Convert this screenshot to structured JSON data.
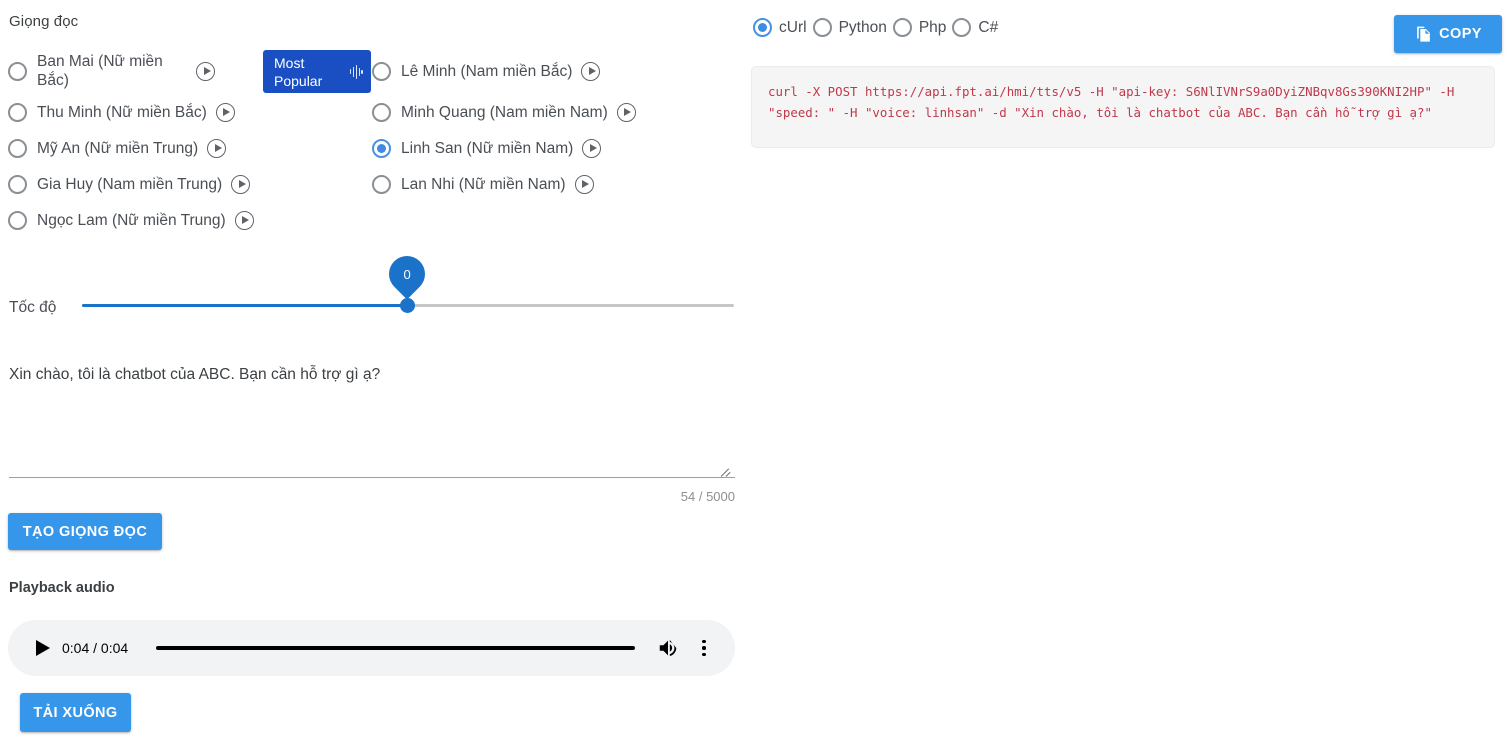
{
  "voice_section": {
    "label": "Giọng đọc",
    "column_left": [
      {
        "name": "Ban Mai (Nữ miền Bắc)",
        "selected": false,
        "play_icon": "play-circle-icon",
        "wrap": true
      },
      {
        "name": "Thu Minh (Nữ miền Bắc)",
        "selected": false,
        "play_icon": "play-circle-icon",
        "wrap": false
      },
      {
        "name": "Mỹ An (Nữ miền Trung)",
        "selected": false,
        "play_icon": "play-circle-icon",
        "wrap": false
      },
      {
        "name": "Gia Huy (Nam miền Trung)",
        "selected": false,
        "play_icon": "play-circle-icon",
        "wrap": false
      },
      {
        "name": "Ngọc Lam (Nữ miền Trung)",
        "selected": false,
        "play_icon": "play-circle-icon",
        "wrap": false
      }
    ],
    "column_right": [
      {
        "name": "Lê Minh (Nam miền Bắc)",
        "selected": false,
        "play_icon": "play-circle-icon",
        "wrap": false
      },
      {
        "name": "Minh Quang (Nam miền Nam)",
        "selected": false,
        "play_icon": "play-circle-icon",
        "wrap": false
      },
      {
        "name": "Linh San (Nữ miền Nam)",
        "selected": true,
        "play_icon": "play-circle-icon",
        "wrap": false
      },
      {
        "name": "Lan Nhi (Nữ miền Nam)",
        "selected": false,
        "play_icon": "play-circle-icon",
        "wrap": false
      }
    ],
    "badge": {
      "line1": "Most",
      "line2": "Popular",
      "icon": "audio-waveform-icon",
      "color": "#1a4fc4"
    }
  },
  "speed": {
    "label": "Tốc độ",
    "value": "0",
    "min": -3,
    "max": 3,
    "fill_color": "#1a73c8"
  },
  "textarea": {
    "value": "Xin chào, tôi là chatbot của ABC. Bạn cần hỗ trợ gì ạ?",
    "placeholder": "",
    "char_count": "54 / 5000",
    "misspelled": [
      "chào",
      "tôi",
      "là",
      "của",
      "Bạn",
      "cần",
      "hỗ",
      "trợ",
      "gì",
      "ạ"
    ]
  },
  "buttons": {
    "generate": "TẠO GIỌNG ĐỌC",
    "download": "TẢI XUỐNG",
    "copy": "COPY",
    "copy_icon": "copy-icon",
    "accent": "#3697ea"
  },
  "playback": {
    "label": "Playback audio",
    "current_time": "0:04",
    "duration": "0:04",
    "time_display": "0:04 / 0:04",
    "progress_percent": 100,
    "play_icon": "play-icon",
    "volume_icon": "volume-icon",
    "menu_icon": "more-vertical-icon"
  },
  "code_panel": {
    "languages": [
      {
        "label": "cUrl",
        "selected": true
      },
      {
        "label": "Python",
        "selected": false
      },
      {
        "label": "Php",
        "selected": false
      },
      {
        "label": "C#",
        "selected": false
      }
    ],
    "snippet": "curl -X POST https://api.fpt.ai/hmi/tts/v5 -H \"api-key: S6NlIVNrS9a0DyiZNBqv8Gs390KNI2HP\" -H \"speed: \" -H \"voice: linhsan\" -d \"Xin chào, tôi là chatbot của ABC. Bạn cần hỗ trợ gì ạ?\"",
    "code_color": "#c0394b",
    "background": "#f5f5f5"
  }
}
